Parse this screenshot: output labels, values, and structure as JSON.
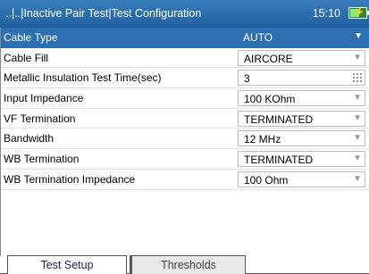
{
  "header": {
    "title": "..|..|Inactive Pair Test|Test Configuration",
    "time": "15:10",
    "battery_icon": "battery-charging-icon",
    "battery_level": 0.6
  },
  "settings": [
    {
      "label": "Cable Type",
      "value": "AUTO",
      "control": "dropdown",
      "selected": true
    },
    {
      "label": "Cable Fill",
      "value": "AIRCORE",
      "control": "dropdown"
    },
    {
      "label": "Metallic Insulation Test Time(sec)",
      "value": "3",
      "control": "numeric"
    },
    {
      "label": "Input Impedance",
      "value": "100 KOhm",
      "control": "dropdown"
    },
    {
      "label": "VF Termination",
      "value": "TERMINATED",
      "control": "dropdown"
    },
    {
      "label": "Bandwidth",
      "value": "12 MHz",
      "control": "dropdown"
    },
    {
      "label": "WB Termination",
      "value": "TERMINATED",
      "control": "dropdown"
    },
    {
      "label": "WB Termination Impedance",
      "value": "100 Ohm",
      "control": "dropdown"
    }
  ],
  "tabs": [
    {
      "label": "Test Setup",
      "active": true
    },
    {
      "label": "Thresholds",
      "active": false
    }
  ],
  "colors": {
    "header_bg": "#2a6aa8",
    "selected_row": "#2c6fb2"
  }
}
